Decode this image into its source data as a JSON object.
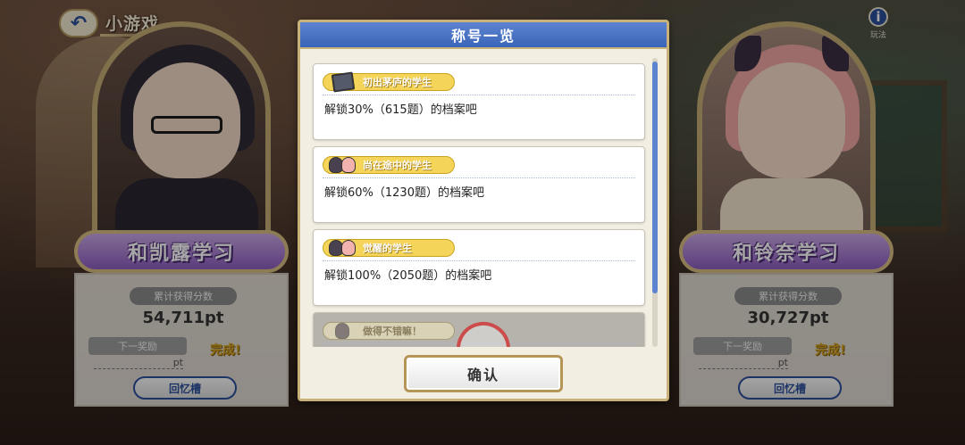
{
  "screen": {
    "title": "小游戏",
    "back_icon": "back-arrow-icon",
    "info_label": "玩法",
    "info_icon": "info-icon"
  },
  "characters": {
    "left": {
      "name": "和凯露学习",
      "score_label": "累计获得分数",
      "score": "54,711pt",
      "next_label": "下一奖励",
      "next_pt": "pt",
      "status": "完成!",
      "memory_button": "回忆槽"
    },
    "right": {
      "name": "和铃奈学习",
      "score_label": "累计获得分数",
      "score": "30,727pt",
      "next_label": "下一奖励",
      "next_pt": "pt",
      "status": "完成!",
      "memory_button": "回忆槽"
    }
  },
  "modal": {
    "title": "称号一览",
    "items": [
      {
        "title": "初出茅庐的学生",
        "desc": "解锁30%（615题）的档案吧",
        "icon": "book-icon",
        "locked": false
      },
      {
        "title": "尚在途中的学生",
        "desc": "解锁60%（1230题）的档案吧",
        "icon": "character-faces-icon",
        "locked": false
      },
      {
        "title": "觉醒的学生",
        "desc": "解锁100%（2050题）的档案吧",
        "icon": "character-faces-icon",
        "locked": false
      },
      {
        "title": "做得不错嘛！",
        "desc": "",
        "icon": "character-face-icon",
        "locked": true
      }
    ],
    "confirm_label": "确认"
  },
  "colors": {
    "accent_blue": "#3a64b8",
    "tag_gold": "#f4d55a",
    "plate_purple": "#8d5dc0",
    "stamp_red": "#d03a3a"
  }
}
